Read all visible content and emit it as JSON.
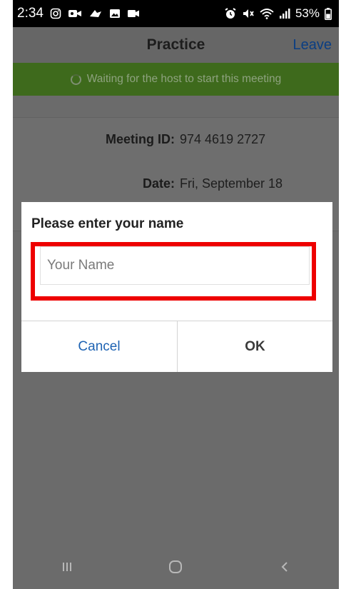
{
  "status_bar": {
    "time": "2:34",
    "battery": "53%",
    "left_icons": [
      "instagram-icon",
      "video-app-icon",
      "app-notification-icon",
      "gallery-icon",
      "video-camera-icon"
    ],
    "right_icons": [
      "alarm-icon",
      "mute-icon",
      "wifi-icon",
      "signal-icon",
      "battery-icon"
    ]
  },
  "header": {
    "title": "Practice",
    "leave_label": "Leave"
  },
  "banner": {
    "text": "Waiting for the host to start this meeting"
  },
  "meeting_info": {
    "id_label": "Meeting ID:",
    "id_value": "974 4619 2727",
    "date_label": "Date:",
    "date_value": "Fri, September 18"
  },
  "dialog": {
    "title": "Please enter your name",
    "name_placeholder": "Your Name",
    "name_value": "",
    "cancel_label": "Cancel",
    "ok_label": "OK"
  },
  "nav_bar": {
    "buttons": [
      "recent-apps-icon",
      "home-icon",
      "back-icon"
    ]
  },
  "colors": {
    "highlight": "#ee0000",
    "link": "#1e63b3",
    "banner": "#3e6a1c"
  }
}
